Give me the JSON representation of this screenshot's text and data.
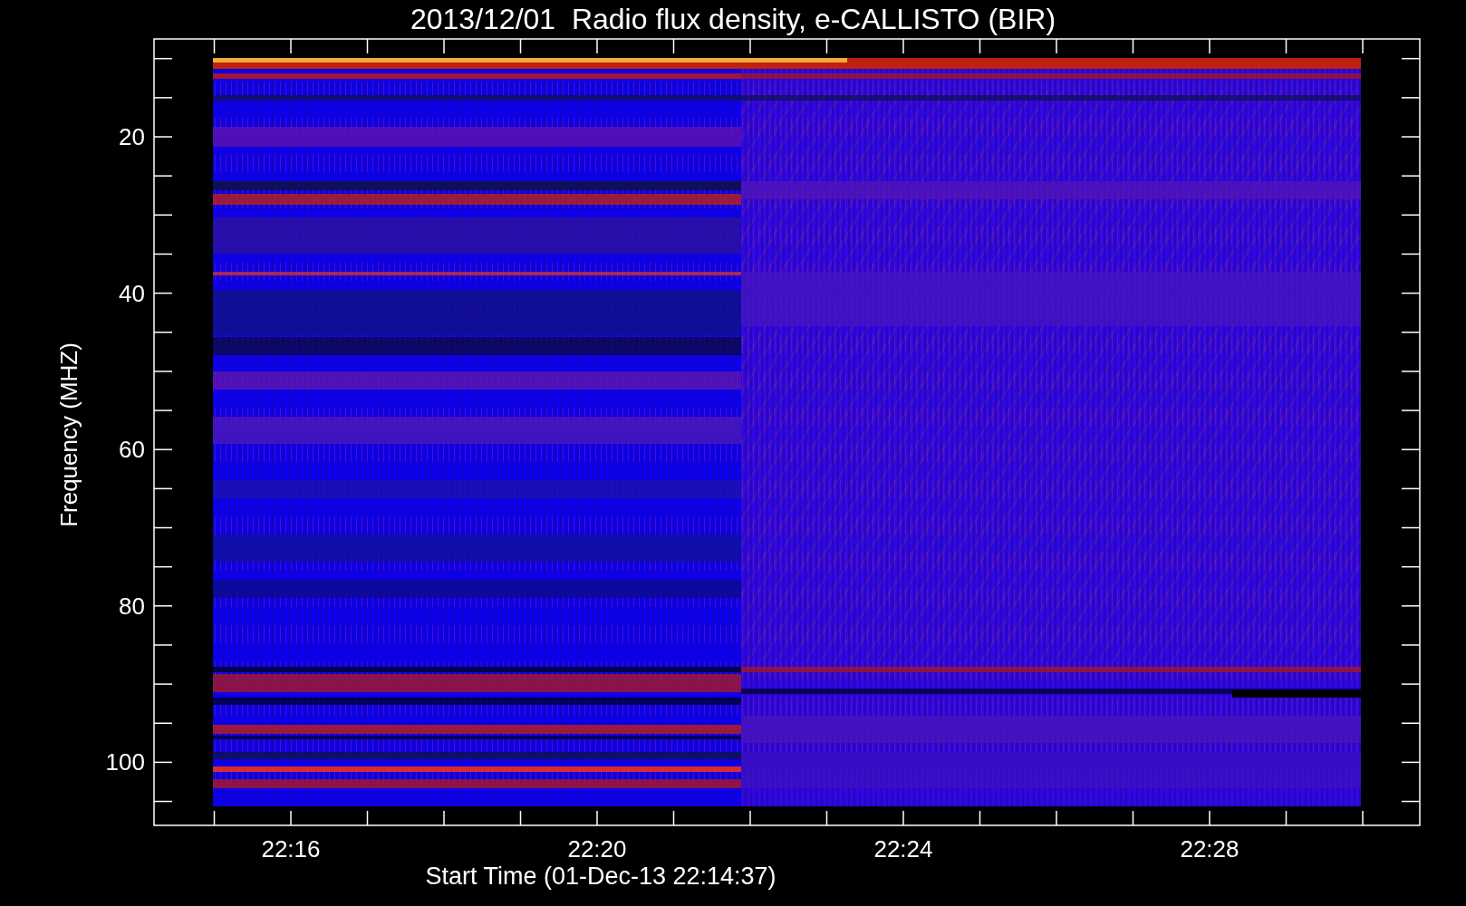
{
  "title": "2013/12/01  Radio flux density, e-CALLISTO (BIR)",
  "y_axis": {
    "label": "Frequency (MHZ)",
    "ticks": [
      "20",
      "40",
      "60",
      "80",
      "100"
    ]
  },
  "x_axis": {
    "label": "Start Time (01-Dec-13 22:14:37)",
    "ticks": [
      "22:16",
      "22:20",
      "22:24",
      "22:28"
    ]
  }
}
